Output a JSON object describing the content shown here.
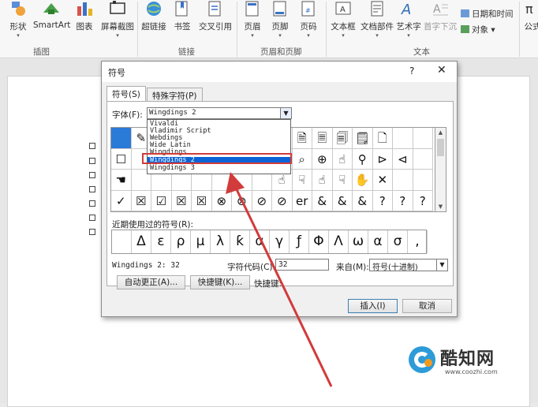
{
  "ribbon": {
    "buttons": [
      {
        "label": "形状",
        "caret": "▾"
      },
      {
        "label": "SmartArt",
        "caret": ""
      },
      {
        "label": "图表",
        "caret": ""
      },
      {
        "label": "屏幕截图",
        "caret": "▾"
      },
      {
        "label": "超链接",
        "caret": ""
      },
      {
        "label": "书签",
        "caret": ""
      },
      {
        "label": "交叉引用",
        "caret": ""
      },
      {
        "label": "页眉",
        "caret": "▾"
      },
      {
        "label": "页脚",
        "caret": "▾"
      },
      {
        "label": "页码",
        "caret": "▾"
      },
      {
        "label": "文本框",
        "caret": "▾"
      },
      {
        "label": "文档部件",
        "caret": "▾"
      },
      {
        "label": "艺术字",
        "caret": "▾"
      },
      {
        "label": "首字下沉",
        "caret": "▾"
      },
      {
        "label": "公式",
        "caret": ""
      }
    ],
    "groups": [
      "插图",
      "链接",
      "页眉和页脚",
      "文本"
    ],
    "side_items": [
      "日期和时间",
      "对象 ▾"
    ]
  },
  "dialog": {
    "title": "符号",
    "help": "?",
    "close": "✕",
    "tabs": [
      "符号(S)",
      "特殊字符(P)"
    ],
    "font_label": "字体(F):",
    "font_value": "Wingdings 2",
    "font_list": [
      "Vivaldi",
      "Vladimir Script",
      "Webdings",
      "Wide Latin",
      "Wingdings",
      "Wingdings 2",
      "Wingdings 3"
    ],
    "font_list_selected": "Wingdings 2",
    "symbol_rows": [
      [
        "",
        "✎",
        "",
        "",
        "",
        "",
        "",
        "🗋",
        "🗍",
        "🗎",
        "🗏",
        "🗐",
        "🗒",
        "🗋"
      ],
      [
        "☐",
        "",
        "",
        "",
        "",
        "",
        "",
        "",
        "⊙",
        "⌕",
        "⊕",
        "☝",
        "⚲",
        "⊳",
        "⊲"
      ],
      [
        "☚",
        "",
        "",
        "",
        "",
        "",
        "",
        "",
        "☝",
        "☟",
        "☝",
        "☟",
        "✋",
        "✕"
      ],
      [
        "✓",
        "☒",
        "☑",
        "☒",
        "☒",
        "⊗",
        "⊗",
        "⊘",
        "⊘",
        "er",
        "&",
        "&",
        "&",
        "?",
        "?",
        "?"
      ]
    ],
    "recent_label": "近期使用过的符号(R):",
    "recent_symbols": [
      "",
      "Δ",
      "ε",
      "ρ",
      "μ",
      "λ",
      "ƙ",
      "α",
      "γ",
      "ƒ",
      "Φ",
      "Λ",
      "ω",
      "α",
      "σ",
      ","
    ],
    "info_font_code": "Wingdings 2: 32",
    "char_code_label": "字符代码(C):",
    "char_code_value": "32",
    "from_label": "来自(M):",
    "from_value": "符号(十进制)",
    "autocorrect_button": "自动更正(A)...",
    "shortcut_button": "快捷键(K)...",
    "shortcut_label": "快捷键:",
    "insert_button": "插入(I)",
    "cancel_button": "取消"
  },
  "watermark": {
    "name": "酷知网",
    "url": "www.coozhi.com"
  },
  "colors": {
    "accent": "#0a64d8",
    "annotation": "#d23b3b",
    "watermark_blue": "#2d9bd8",
    "watermark_orange": "#f39a1e"
  }
}
